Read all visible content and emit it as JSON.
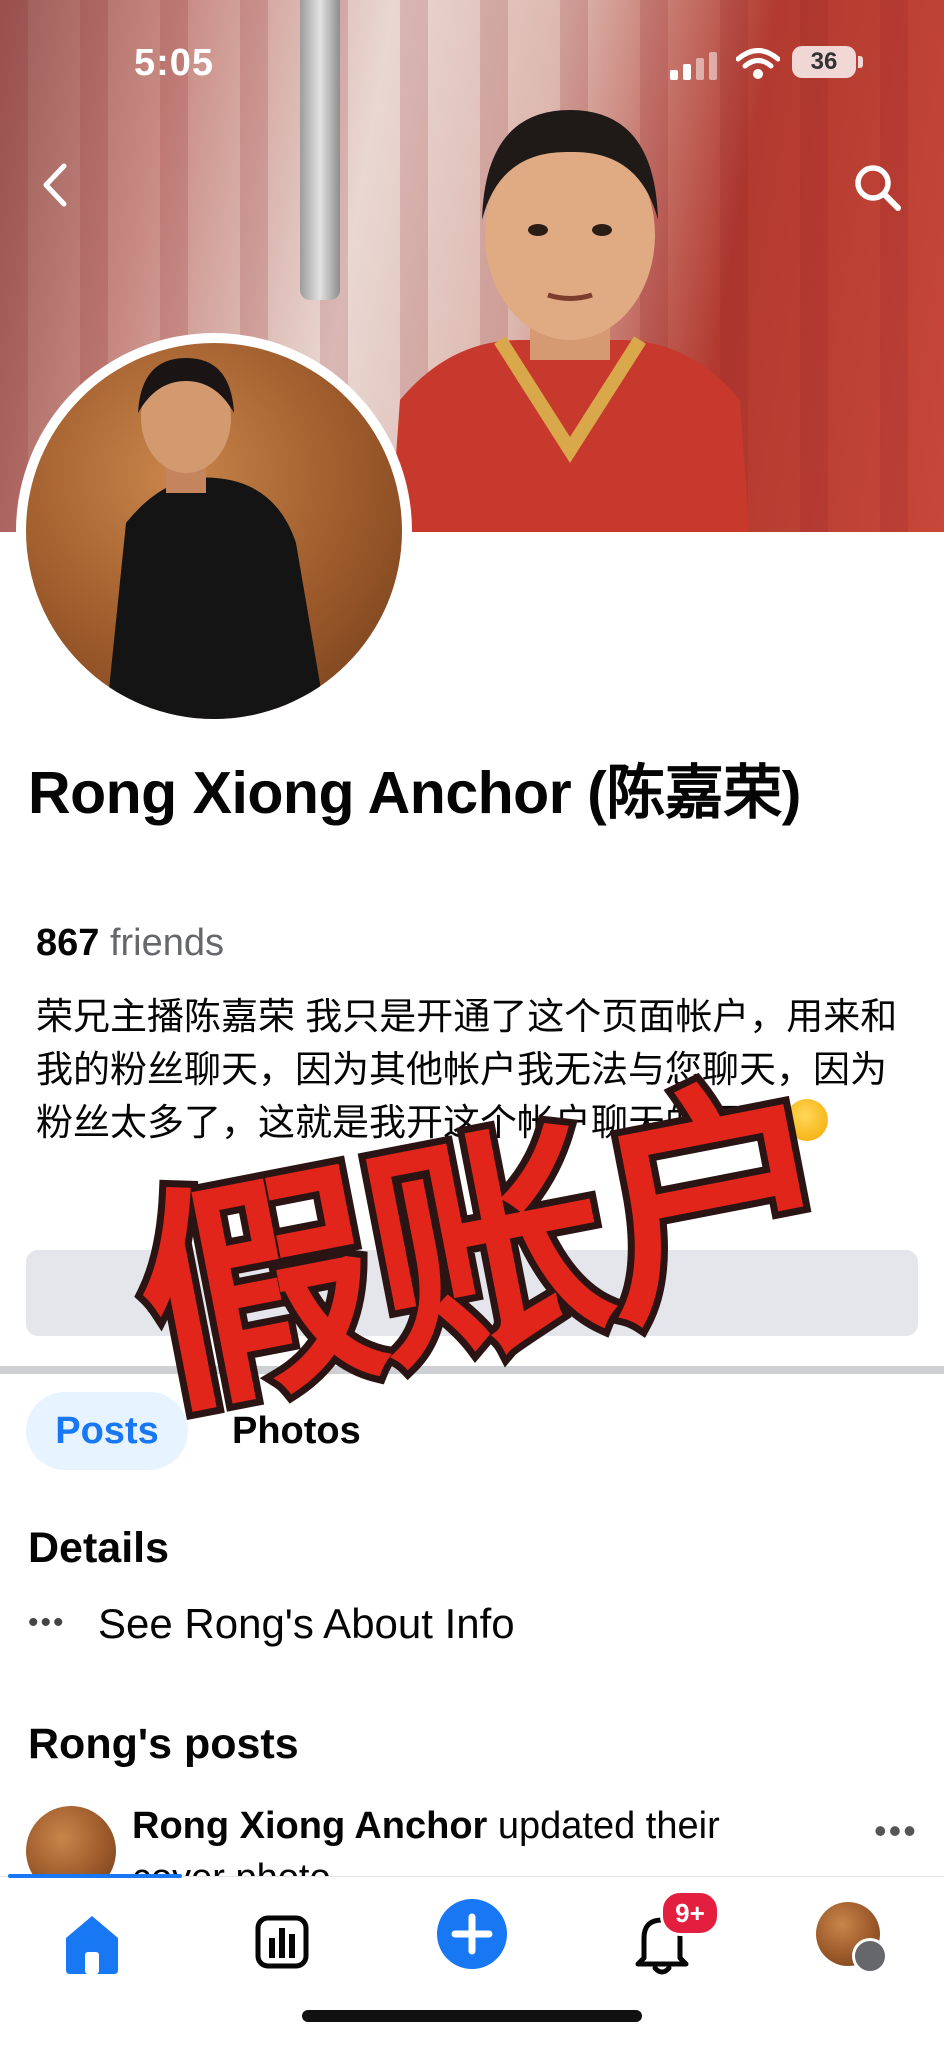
{
  "status_bar": {
    "time": "5:05",
    "battery": "36"
  },
  "profile": {
    "name": "Rong Xiong Anchor (陈嘉荣)",
    "friends_count": "867",
    "friends_label": "friends",
    "bio": "荣兄主播陈嘉荣   我只是开通了这个页面帐户，用来和我的粉丝聊天，因为其他帐户我无法与您聊天，因为粉丝太多了，这就是我开这个帐户聊天的原因"
  },
  "stamp": {
    "text": "假账户",
    "color": "#e1251b"
  },
  "tabs": [
    {
      "label": "Posts"
    },
    {
      "label": "Photos"
    }
  ],
  "details": {
    "title": "Details",
    "about_link": "See Rong's About Info"
  },
  "posts": {
    "title": "Rong's posts",
    "first_post": {
      "author": "Rong Xiong Anchor",
      "action": " updated their cover photo"
    }
  },
  "nav": {
    "notifications_badge": "9+"
  },
  "icons": [
    "back-icon",
    "search-icon",
    "home-icon",
    "dashboard-icon",
    "create-icon",
    "notifications-icon",
    "profile-icon"
  ],
  "colors": {
    "accent": "#1877f2",
    "badge": "#e41e3f"
  }
}
